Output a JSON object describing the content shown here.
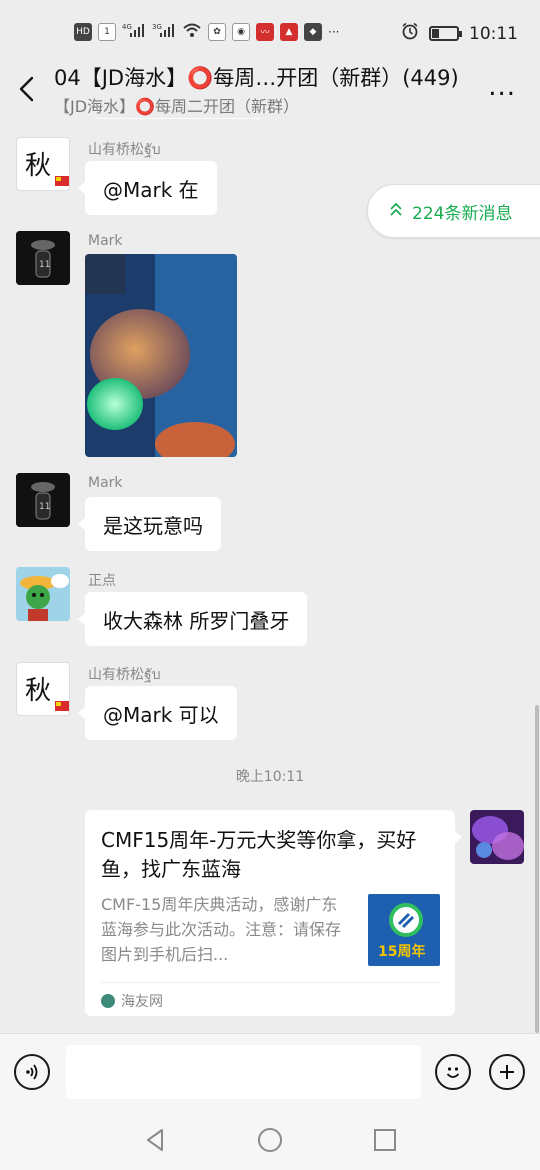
{
  "status_bar": {
    "left_chips": [
      "HD",
      "1",
      "4G",
      "3G"
    ],
    "time": "10:11"
  },
  "header": {
    "title": "04【JD海水】⭕每周…开团（新群）(449)",
    "subtitle": "【JD海水】⭕每周二开团（新群）",
    "more_label": "..."
  },
  "new_messages": {
    "label": "224条新消息"
  },
  "messages": [
    {
      "sender": "山有桥松ฐับ",
      "text": "@Mark  在"
    },
    {
      "sender": "Mark",
      "text": ""
    },
    {
      "sender": "Mark",
      "text": "是这玩意吗"
    },
    {
      "sender": "正点",
      "text": "收大森林 所罗门叠牙"
    },
    {
      "sender": "山有桥松ฐับ",
      "text": "@Mark  可以"
    }
  ],
  "timestamp": "晚上10:11",
  "link_card": {
    "title": "CMF15周年-万元大奖等你拿，买好鱼，找广东蓝海",
    "description": "CMF-15周年庆典活动，感谢广东蓝海参与此次活动。注意：请保存图片到手机后扫...",
    "source": "海友网",
    "thumb_text": "15周年"
  },
  "input_bar": {
    "placeholder": ""
  },
  "colors": {
    "accent_green": "#1aad52",
    "background": "#ededed",
    "bubble": "#ffffff"
  },
  "icons": [
    "back-icon",
    "voice-icon",
    "emoji-icon",
    "plus-icon",
    "nav-back-icon",
    "nav-home-icon",
    "nav-recent-icon"
  ]
}
